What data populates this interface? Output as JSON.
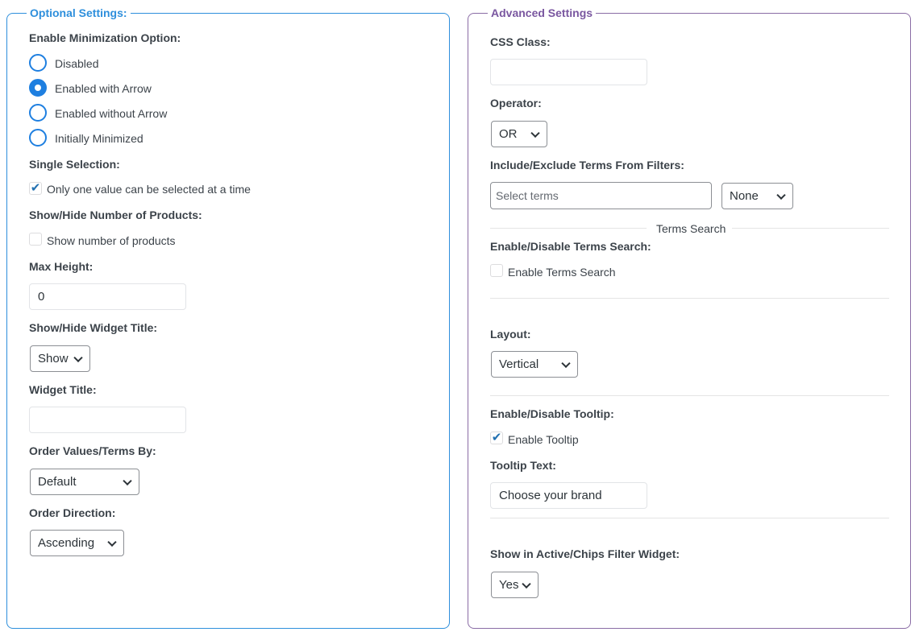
{
  "optional": {
    "legend": "Optional Settings:",
    "minimization_label": "Enable Minimization Option:",
    "minimization_options": [
      "Disabled",
      "Enabled with Arrow",
      "Enabled without Arrow",
      "Initially Minimized"
    ],
    "minimization_selected": "Enabled with Arrow",
    "single_selection_label": "Single Selection:",
    "single_selection_option": "Only one value can be selected at a time",
    "single_selection_checked": true,
    "show_products_label": "Show/Hide Number of Products:",
    "show_products_option": "Show number of products",
    "show_products_checked": false,
    "max_height_label": "Max Height:",
    "max_height_value": "0",
    "widget_title_toggle_label": "Show/Hide Widget Title:",
    "widget_title_toggle_value": "Show",
    "widget_title_label": "Widget Title:",
    "widget_title_value": "",
    "order_by_label": "Order Values/Terms By:",
    "order_by_value": "Default",
    "order_direction_label": "Order Direction:",
    "order_direction_value": "Ascending"
  },
  "advanced": {
    "legend": "Advanced Settings",
    "css_class_label": "CSS Class:",
    "css_class_value": "",
    "operator_label": "Operator:",
    "operator_value": "OR",
    "include_exclude_label": "Include/Exclude Terms From Filters:",
    "terms_placeholder": "Select terms",
    "include_exclude_value": "None",
    "terms_search_divider": "Terms Search",
    "terms_search_label": "Enable/Disable Terms Search:",
    "terms_search_option": "Enable Terms Search",
    "terms_search_checked": false,
    "layout_label": "Layout:",
    "layout_value": "Vertical",
    "tooltip_label": "Enable/Disable Tooltip:",
    "tooltip_option": "Enable Tooltip",
    "tooltip_checked": true,
    "tooltip_text_label": "Tooltip Text:",
    "tooltip_text_value": "Choose your brand",
    "active_chips_label": "Show in Active/Chips Filter Widget:",
    "active_chips_value": "Yes"
  },
  "colors": {
    "optional_border": "#2e8fdc",
    "advanced_border": "#8a6ca5",
    "radio_accent": "#1e7fe0",
    "check_accent": "#2271b1"
  },
  "icons": {
    "checkmark": "check-icon",
    "dropdown": "chevron-down-icon"
  }
}
